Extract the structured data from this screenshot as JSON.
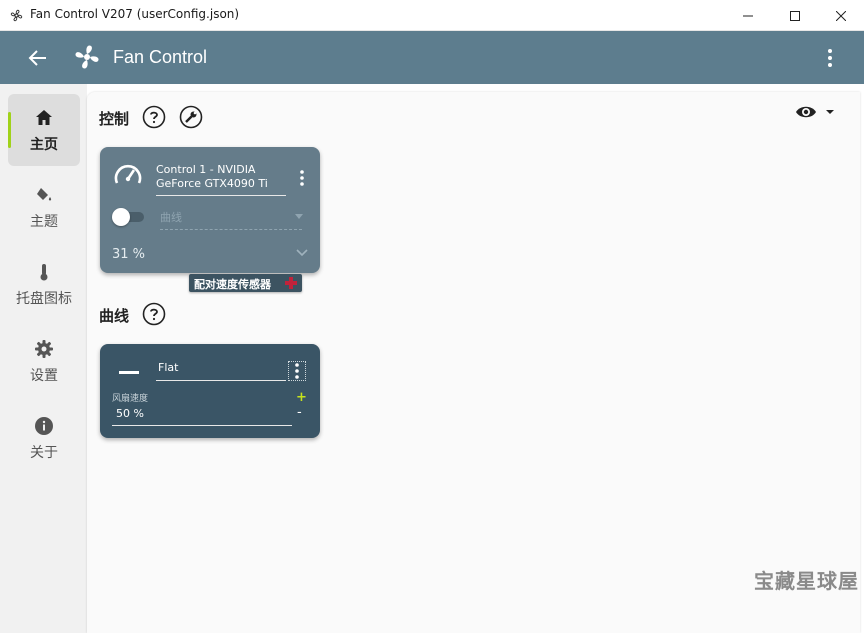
{
  "window": {
    "title": "Fan Control V207 (userConfig.json)"
  },
  "appbar": {
    "title": "Fan Control"
  },
  "sidebar": {
    "items": [
      {
        "label": "主页",
        "icon": "home-icon",
        "active": true
      },
      {
        "label": "主题",
        "icon": "paint-bucket-icon",
        "active": false
      },
      {
        "label": "托盘图标",
        "icon": "thermometer-icon",
        "active": false
      },
      {
        "label": "设置",
        "icon": "gear-icon",
        "active": false
      },
      {
        "label": "关于",
        "icon": "info-icon",
        "active": false
      }
    ]
  },
  "sections": {
    "controls_title": "控制",
    "curves_title": "曲线"
  },
  "control_card": {
    "name_line1": "Control 1 - NVIDIA",
    "name_line2": "GeForce GTX4090 Ti",
    "enabled": false,
    "curve_placeholder": "曲线",
    "percent": "31 %",
    "pair_button_label": "配对速度传感器"
  },
  "curve_card": {
    "name": "Flat",
    "fan_speed_label": "风扇速度",
    "fan_speed_value": "50 %",
    "plus": "+",
    "minus": "-"
  },
  "watermark": "宝藏星球屋",
  "colors": {
    "appbar": "#5d7d8e",
    "control_card": "#657c8a",
    "curve_card": "#3a5566",
    "accent": "#a0d21a",
    "pair_plus": "#c0233b"
  }
}
